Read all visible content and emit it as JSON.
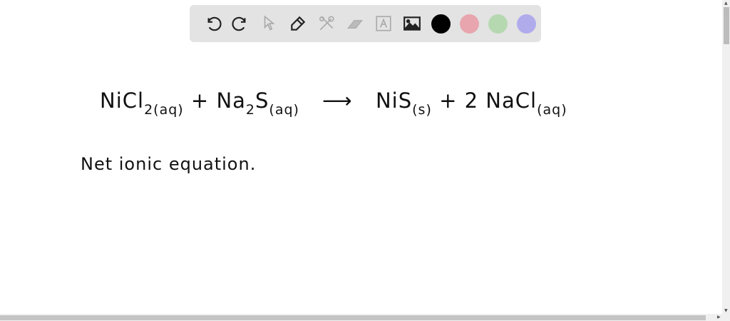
{
  "toolbar": {
    "tools": [
      "undo",
      "redo",
      "select",
      "pen",
      "tools",
      "eraser",
      "text",
      "image"
    ],
    "colors": [
      "#000000",
      "#e8a5ad",
      "#b5d8b0",
      "#b0acec"
    ]
  },
  "canvas": {
    "reactant1": "NiCl",
    "reactant1_sub": "2",
    "reactant1_state": "(aq)",
    "plus1": "+",
    "reactant2": "Na",
    "reactant2_sub": "2",
    "reactant2_s": "S",
    "reactant2_state": "(aq)",
    "arrow": "⟶",
    "product1": "NiS",
    "product1_state": "(s)",
    "plus2": "+",
    "product2": "2 NaCl",
    "product2_state": "(aq)",
    "note": "Net ionic equation."
  }
}
